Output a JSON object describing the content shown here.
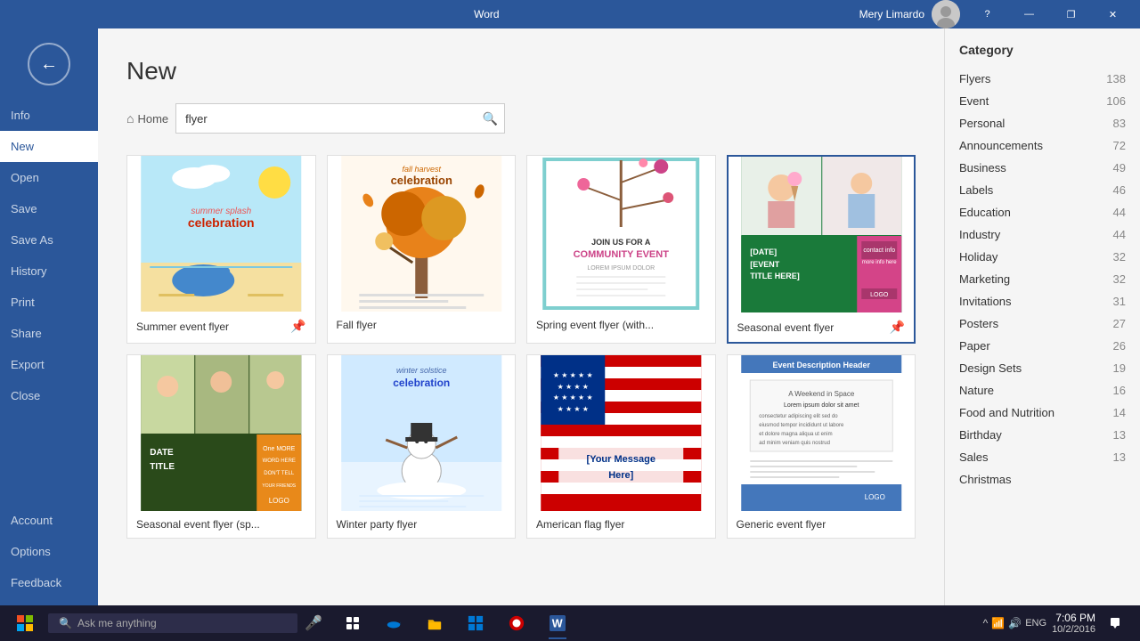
{
  "titlebar": {
    "app_name": "Word",
    "user_name": "Mery Limardo",
    "help_label": "?",
    "minimize_label": "—",
    "restore_label": "❐",
    "close_label": "✕"
  },
  "sidebar": {
    "back_label": "←",
    "items": [
      {
        "id": "info",
        "label": "Info"
      },
      {
        "id": "new",
        "label": "New",
        "active": true
      },
      {
        "id": "open",
        "label": "Open"
      },
      {
        "id": "save",
        "label": "Save"
      },
      {
        "id": "save-as",
        "label": "Save As"
      },
      {
        "id": "history",
        "label": "History"
      },
      {
        "id": "print",
        "label": "Print"
      },
      {
        "id": "share",
        "label": "Share"
      },
      {
        "id": "export",
        "label": "Export"
      },
      {
        "id": "close",
        "label": "Close"
      }
    ],
    "bottom_items": [
      {
        "id": "account",
        "label": "Account"
      },
      {
        "id": "options",
        "label": "Options"
      },
      {
        "id": "feedback",
        "label": "Feedback"
      }
    ]
  },
  "page": {
    "title": "New",
    "home_label": "Home",
    "search_placeholder": "flyer",
    "search_value": "flyer"
  },
  "templates": [
    {
      "id": "summer-event",
      "label": "Summer event flyer",
      "pinned": true,
      "selected": false,
      "style": "summer"
    },
    {
      "id": "fall-flyer",
      "label": "Fall flyer",
      "pinned": false,
      "selected": false,
      "style": "fall"
    },
    {
      "id": "spring-event",
      "label": "Spring event flyer (with...",
      "pinned": false,
      "selected": false,
      "style": "spring"
    },
    {
      "id": "seasonal-event",
      "label": "Seasonal event flyer",
      "pinned": true,
      "selected": true,
      "style": "seasonal"
    },
    {
      "id": "seasonal-sp",
      "label": "Seasonal event flyer (sp...",
      "pinned": false,
      "selected": false,
      "style": "seasonal-sp"
    },
    {
      "id": "winter-party",
      "label": "Winter party flyer",
      "pinned": false,
      "selected": false,
      "style": "winter"
    },
    {
      "id": "american-flag",
      "label": "American flag flyer",
      "pinned": false,
      "selected": false,
      "style": "american"
    },
    {
      "id": "generic-event",
      "label": "Generic event flyer",
      "pinned": false,
      "selected": false,
      "style": "generic"
    }
  ],
  "categories": {
    "title": "Category",
    "items": [
      {
        "label": "Flyers",
        "count": 138
      },
      {
        "label": "Event",
        "count": 106
      },
      {
        "label": "Personal",
        "count": 83
      },
      {
        "label": "Announcements",
        "count": 72
      },
      {
        "label": "Business",
        "count": 49
      },
      {
        "label": "Labels",
        "count": 46
      },
      {
        "label": "Education",
        "count": 44
      },
      {
        "label": "Industry",
        "count": 44
      },
      {
        "label": "Holiday",
        "count": 32
      },
      {
        "label": "Marketing",
        "count": 32
      },
      {
        "label": "Invitations",
        "count": 31
      },
      {
        "label": "Posters",
        "count": 27
      },
      {
        "label": "Paper",
        "count": 26
      },
      {
        "label": "Design Sets",
        "count": 19
      },
      {
        "label": "Nature",
        "count": 16
      },
      {
        "label": "Food and Nutrition",
        "count": 14
      },
      {
        "label": "Birthday",
        "count": 13
      },
      {
        "label": "Sales",
        "count": 13
      },
      {
        "label": "Christmas",
        "count": ""
      }
    ]
  },
  "taskbar": {
    "search_placeholder": "Ask me anything",
    "clock_time": "7:06 PM",
    "clock_date": "10/2/2016",
    "language": "ENG"
  }
}
